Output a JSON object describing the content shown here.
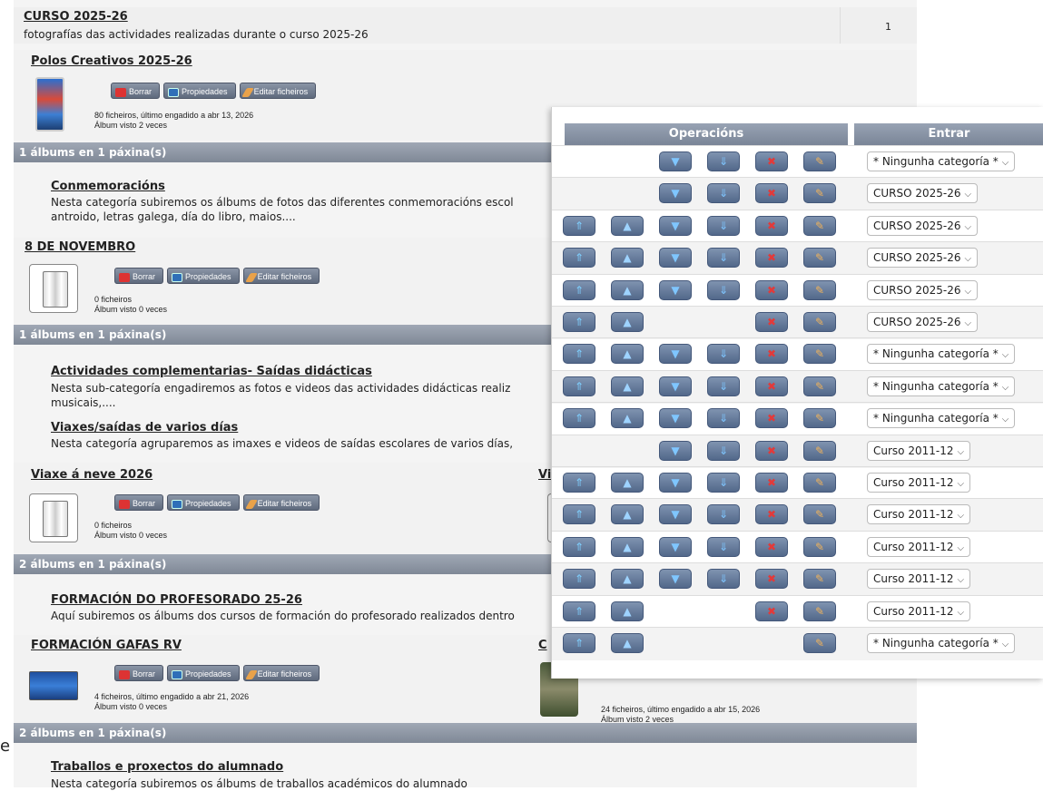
{
  "categories": {
    "curso": {
      "title": "CURSO 2025-26",
      "desc": "fotografías das actividades realizadas durante o curso 2025-26",
      "count": "1"
    },
    "polos": {
      "title": "Polos Creativos 2025-26",
      "info1": "80 ficheiros, último engadido a abr 13, 2026",
      "info2": "Álbum visto 2 veces"
    },
    "conmemoracions": {
      "title": "Conmemoracións",
      "desc1": "Nesta categoría subiremos os álbums de fotos das diferentes conmemoracións escol",
      "desc2": "antroido, letras galega, día do libro, maios...."
    },
    "novembro": {
      "title": "8 DE NOVEMBRO",
      "info1": "0 ficheiros",
      "info2": "Álbum visto 0 veces"
    },
    "complementarias": {
      "title": "Actividades complementarias- Saídas didácticas",
      "desc1": "Nesta sub-categoría engadiremos as fotos e videos das actividades didácticas realiz",
      "desc2": "musicais,...."
    },
    "viaxes": {
      "title": "Viaxes/saídas de varios días",
      "desc1": "Nesta categoría agruparemos as imaxes e videos de saídas escolares de varios días,"
    },
    "neve": {
      "title": "Viaxe á neve 2026",
      "right_frag": "Vi",
      "info1": "0 ficheiros",
      "info2": "Álbum visto 0 veces"
    },
    "formacion": {
      "title": "FORMACIÓN DO PROFESORADO 25-26",
      "desc1": "Aquí subiremos os álbums dos cursos de formación do profesorado realizados dentro"
    },
    "gafas": {
      "title": "FORMACIÓN GAFAS RV",
      "right_frag": "C",
      "info1": "4 ficheiros, último engadido a abr 21, 2026",
      "info2": "Álbum visto 0 veces",
      "right_info1": "24 ficheiros, último engadido a abr 15, 2026",
      "right_info2": "Álbum visto 2 veces"
    },
    "traballos": {
      "title": "Traballos e proxectos do alumnado",
      "desc1": "Nesta categoría subiremos os álbums de traballos académicos do alumnado"
    }
  },
  "buttons": {
    "delete": "Borrar",
    "properties": "Propiedades",
    "edit_files": "Editar ficheiros"
  },
  "stats": {
    "one": "1 álbums en 1 páxina(s)",
    "two": "2 álbums en 1 páxina(s)"
  },
  "edge_char": "e",
  "overlay": {
    "headers": {
      "operations": "Operacións",
      "enter": "Entrar"
    },
    "rows": [
      {
        "ops": [
          "",
          "",
          "dn",
          "bot",
          "del",
          "ed"
        ],
        "select": "* Ningunha categoría *"
      },
      {
        "ops": [
          "",
          "",
          "dn",
          "bot",
          "del",
          "ed"
        ],
        "select": "CURSO 2025-26"
      },
      {
        "ops": [
          "top",
          "up",
          "dn",
          "bot",
          "del",
          "ed"
        ],
        "select": "CURSO 2025-26"
      },
      {
        "ops": [
          "top",
          "up",
          "dn",
          "bot",
          "del",
          "ed"
        ],
        "select": "CURSO 2025-26"
      },
      {
        "ops": [
          "top",
          "up",
          "dn",
          "bot",
          "del",
          "ed"
        ],
        "select": "CURSO 2025-26"
      },
      {
        "ops": [
          "top",
          "up",
          "",
          "",
          "del",
          "ed"
        ],
        "select": "CURSO 2025-26"
      },
      {
        "ops": [
          "top",
          "up",
          "dn",
          "bot",
          "del",
          "ed"
        ],
        "select": "* Ningunha categoría *"
      },
      {
        "ops": [
          "top",
          "up",
          "dn",
          "bot",
          "del",
          "ed"
        ],
        "select": "* Ningunha categoría *"
      },
      {
        "ops": [
          "top",
          "up",
          "dn",
          "bot",
          "del",
          "ed"
        ],
        "select": "* Ningunha categoría *"
      },
      {
        "ops": [
          "",
          "",
          "dn",
          "bot",
          "del",
          "ed"
        ],
        "select": "Curso 2011-12"
      },
      {
        "ops": [
          "top",
          "up",
          "dn",
          "bot",
          "del",
          "ed"
        ],
        "select": "Curso 2011-12"
      },
      {
        "ops": [
          "top",
          "up",
          "dn",
          "bot",
          "del",
          "ed"
        ],
        "select": "Curso 2011-12"
      },
      {
        "ops": [
          "top",
          "up",
          "dn",
          "bot",
          "del",
          "ed"
        ],
        "select": "Curso 2011-12"
      },
      {
        "ops": [
          "top",
          "up",
          "dn",
          "bot",
          "del",
          "ed"
        ],
        "select": "Curso 2011-12"
      },
      {
        "ops": [
          "top",
          "up",
          "",
          "",
          "del",
          "ed"
        ],
        "select": "Curso 2011-12"
      },
      {
        "ops": [
          "top",
          "up",
          "",
          "",
          "",
          "ed"
        ],
        "select": "* Ningunha categoría *"
      }
    ]
  }
}
